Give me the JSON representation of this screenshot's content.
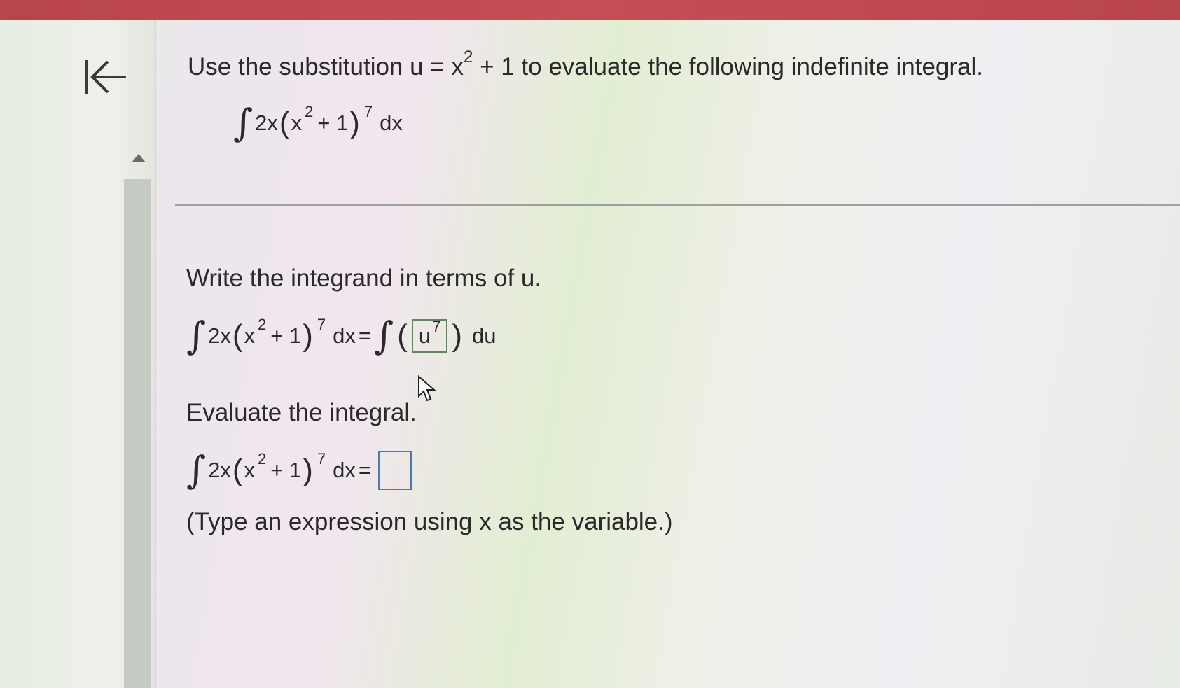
{
  "question": {
    "intro_pre": "Use the substitution u = x",
    "intro_exp": "2",
    "intro_post": " + 1 to evaluate the following indefinite integral."
  },
  "integral": {
    "sign": "∫",
    "coef": "2x",
    "open": "(",
    "base": "x",
    "base_exp": "2",
    "plus_one": "+ 1",
    "close": ")",
    "outer_exp": "7",
    "dx": "dx",
    "equals": "="
  },
  "step1": {
    "prompt": "Write the integrand in terms of u.",
    "answer_base": "u",
    "answer_exp": "7",
    "du": "du"
  },
  "step2": {
    "prompt": "Evaluate the integral.",
    "hint": "(Type an expression using x as the variable.)"
  },
  "icons": {
    "back": "first-page-arrow-icon",
    "scroll_up": "triangle-up-icon",
    "cursor": "mouse-pointer-icon"
  }
}
